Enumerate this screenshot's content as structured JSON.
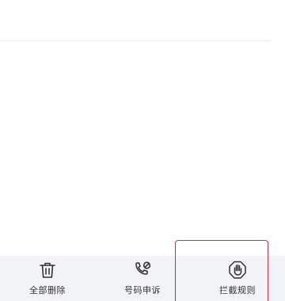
{
  "bottom_bar": {
    "items": [
      {
        "label": "全部删除",
        "icon": "trash-icon"
      },
      {
        "label": "号码申诉",
        "icon": "phone-block-icon"
      },
      {
        "label": "拦截规则",
        "icon": "hand-stop-icon"
      }
    ]
  },
  "colors": {
    "bar_background": "#f2f3f6",
    "highlight_border": "#c8323c",
    "icon_color": "#333333"
  }
}
